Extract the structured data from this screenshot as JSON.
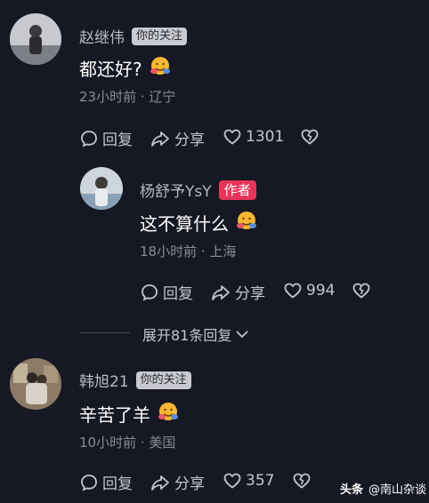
{
  "comments": [
    {
      "author": "赵继伟",
      "follow_badge": "你的关注",
      "text": "都还好?",
      "meta": "23小时前 · 辽宁",
      "reply_label": "回复",
      "share_label": "分享",
      "likes": "1301"
    },
    {
      "author": "杨舒予YsY",
      "author_badge": "作者",
      "text": "这不算什么",
      "meta": "18小时前 · 上海",
      "reply_label": "回复",
      "share_label": "分享",
      "likes": "994"
    },
    {
      "author": "韩旭21",
      "follow_badge": "你的关注",
      "text": "辛苦了羊",
      "meta": "10小时前 · 美国",
      "reply_label": "回复",
      "share_label": "分享",
      "likes": "357"
    }
  ],
  "expand_replies": "展开81条回复",
  "watermark": {
    "brand": "头条",
    "account": "@南山杂谈"
  },
  "colors": {
    "background": "#161823",
    "author_badge": "#e8345a"
  }
}
